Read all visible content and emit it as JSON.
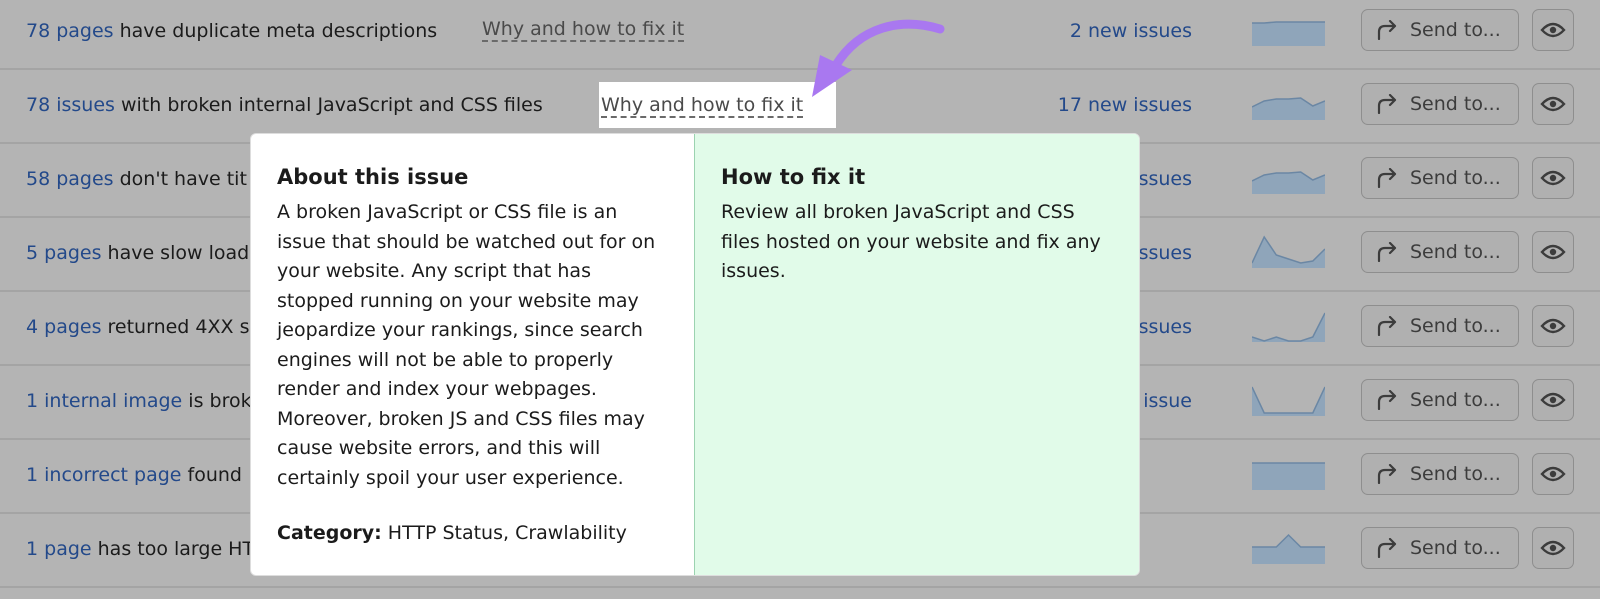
{
  "rows": [
    {
      "link": "78 pages",
      "text": " have duplicate meta descriptions",
      "why": "Why and how to fix it",
      "count": "2 new issues",
      "spark": [
        10,
        10,
        9,
        9,
        9,
        9,
        9
      ]
    },
    {
      "link": "78 issues",
      "text": " with broken internal JavaScript and CSS files",
      "why": "Why and how to fix it",
      "count": "17 new issues",
      "spark": [
        20,
        14,
        12,
        12,
        11,
        19,
        14
      ]
    },
    {
      "link": "58 pages",
      "text": " don't have tit",
      "count": "ssues",
      "spark": [
        20,
        14,
        12,
        12,
        11,
        19,
        14
      ]
    },
    {
      "link": "5 pages",
      "text": " have slow load",
      "count": "ssues",
      "spark": [
        28,
        2,
        20,
        24,
        28,
        26,
        14
      ]
    },
    {
      "link": "4 pages",
      "text": " returned 4XX s",
      "count": "ssues",
      "spark": [
        28,
        32,
        28,
        32,
        32,
        28,
        4
      ]
    },
    {
      "link": "1 internal image",
      "text": " is brok",
      "count": "issue",
      "spark": [
        4,
        30,
        30,
        30,
        30,
        30,
        4
      ]
    },
    {
      "link": "1 incorrect page",
      "text": " found",
      "count": "",
      "spark": [
        6,
        6,
        6,
        6,
        6,
        6,
        6
      ]
    },
    {
      "link": "1 page",
      "text": " has too large HT",
      "count": "",
      "spark": [
        16,
        16,
        16,
        4,
        16,
        16,
        16
      ]
    }
  ],
  "send_label": "Send to...",
  "popup": {
    "about_title": "About this issue",
    "about_text": "A broken JavaScript or CSS file is an issue that should be watched out for on your website. Any script that has stopped running on your website may jeopardize your rankings, since search engines will not be able to properly render and index your webpages. Moreover, broken JS and CSS files may cause website errors, and this will certainly spoil your user experience.",
    "category_label": "Category:",
    "category_value": " HTTP Status, Crawlability",
    "fix_title": "How to fix it",
    "fix_text": "Review all broken JavaScript and CSS files hosted on your website and fix any issues."
  },
  "colors": {
    "arrow": "#a978f0",
    "link": "#23498a",
    "fix_bg": "#e1fbe9"
  }
}
